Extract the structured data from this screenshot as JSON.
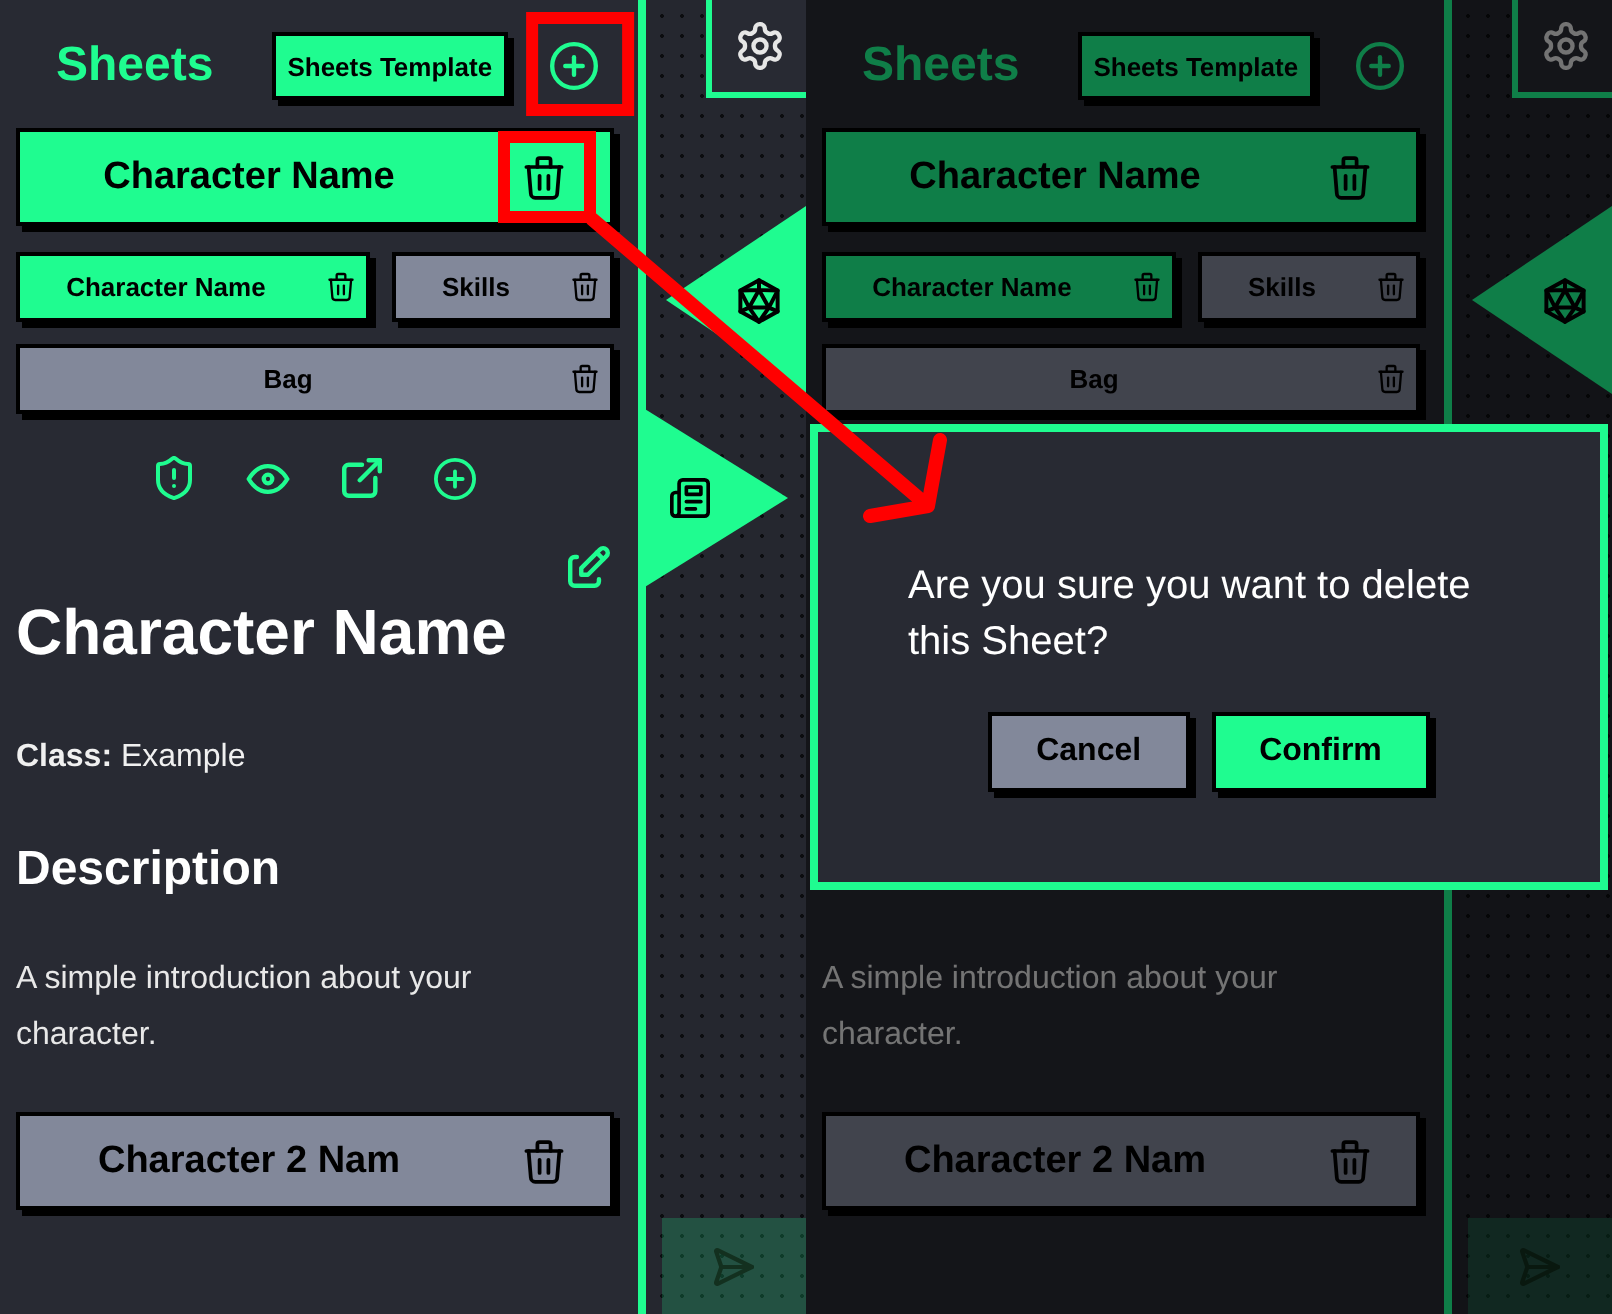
{
  "screens": [
    {
      "dimmed": false,
      "title": "Sheets",
      "template_button": "Sheets Template",
      "characters": [
        {
          "name": "Character Name",
          "selected": true,
          "pages": [
            {
              "label": "Character Name",
              "selected": true
            },
            {
              "label": "Skills",
              "selected": false
            },
            {
              "label": "Bag",
              "selected": false
            }
          ],
          "actions": [
            {
              "kind": "shield"
            },
            {
              "kind": "eye"
            },
            {
              "kind": "external"
            },
            {
              "kind": "plus"
            }
          ],
          "editable": true,
          "details": {
            "title": "Character Name",
            "class_line": "**Class:** Example",
            "heading": "Description",
            "intro": "A simple introduction about your character."
          }
        },
        {
          "name": "Character 2 Nam",
          "selected": false
        }
      ],
      "side_tabs": [
        {
          "kind": "dice"
        },
        {
          "kind": "news"
        }
      ]
    },
    {
      "dimmed": true,
      "title": "Sheets",
      "template_button": "Sheets Template",
      "characters": [
        {
          "name": "Character Name",
          "selected": true,
          "pages": [
            {
              "label": "Character Name",
              "selected": true
            },
            {
              "label": "Skills",
              "selected": false
            },
            {
              "label": "Bag",
              "selected": false
            }
          ],
          "details": {
            "intro": "A simple introduction about your character."
          }
        },
        {
          "name": "Character 2 Nam",
          "selected": false
        }
      ],
      "side_tabs": [
        {
          "kind": "dice"
        }
      ],
      "dialog": {
        "message": "Are you sure you want to delete this Sheet?",
        "buttons": [
          {
            "label": "Cancel",
            "kind": "cancel"
          },
          {
            "label": "Confirm",
            "kind": "confirm"
          }
        ]
      }
    }
  ]
}
